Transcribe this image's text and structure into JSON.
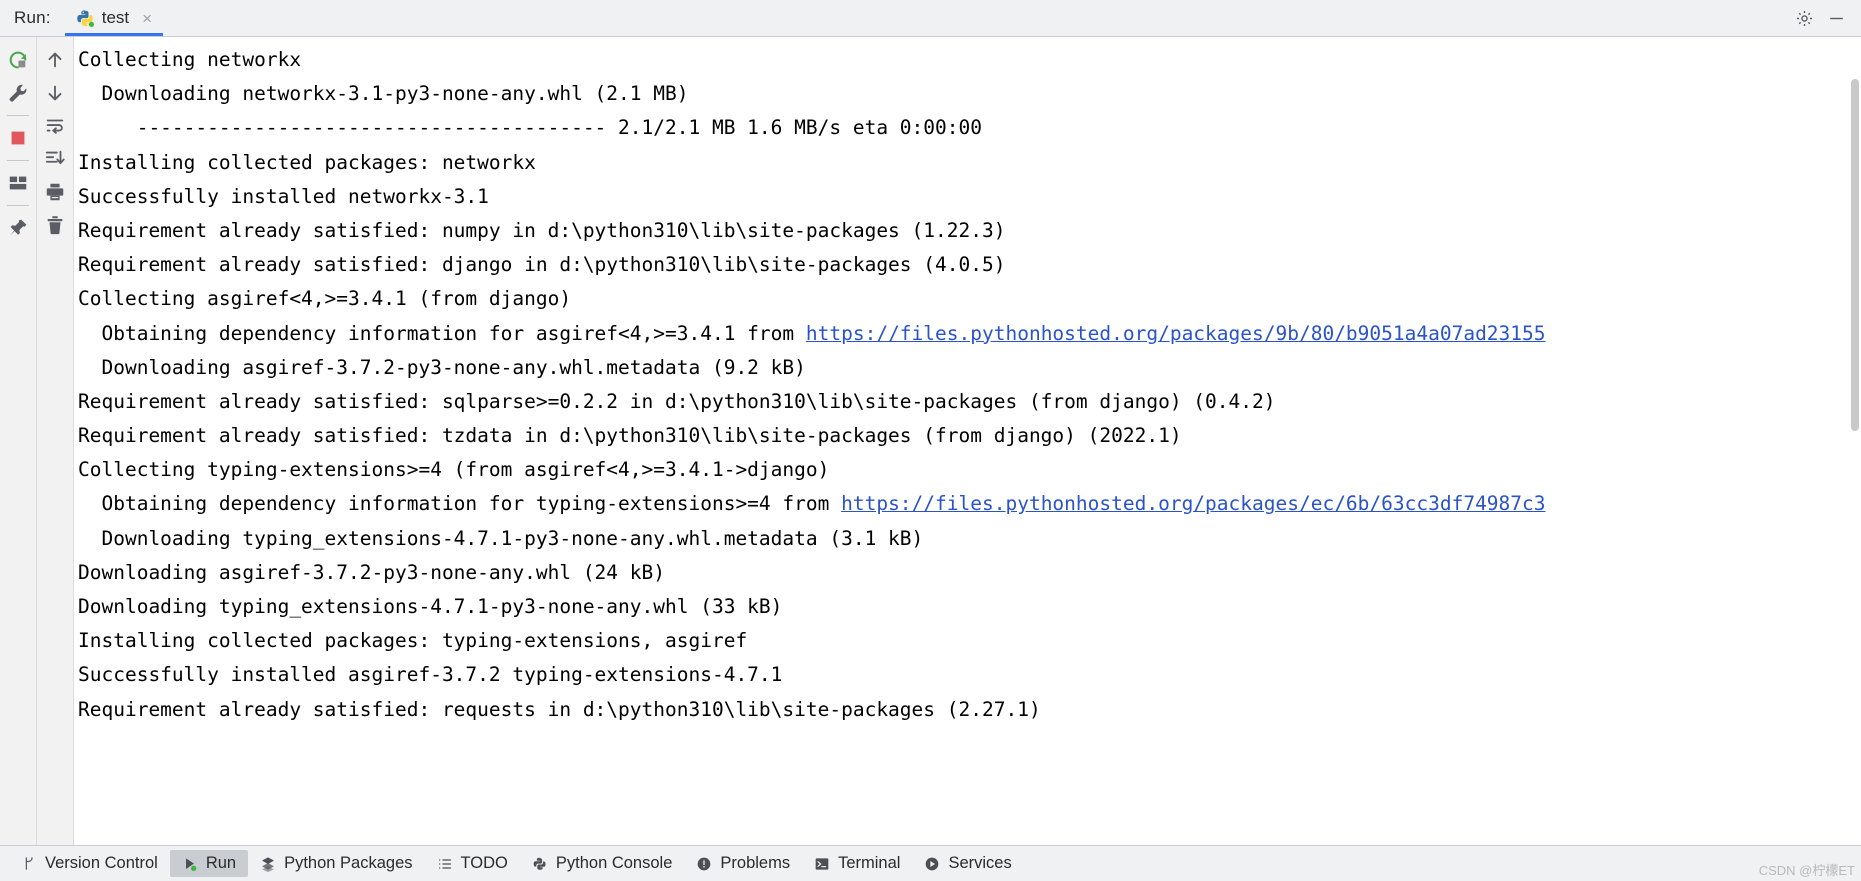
{
  "topbar": {
    "run_label": "Run:",
    "tab": {
      "title": "test",
      "close": "×",
      "icon": "python-icon"
    },
    "settings_icon": "gear-icon",
    "minimize_icon": "minimize-icon"
  },
  "gutter_left": [
    {
      "name": "rerun-icon",
      "label": "Rerun"
    },
    {
      "name": "wrench-icon",
      "label": "Modify Run Configuration"
    },
    {
      "name": "stop-icon",
      "label": "Stop"
    },
    {
      "name": "layout-icon",
      "label": "Layout"
    },
    {
      "name": "pin-icon",
      "label": "Pin Tab"
    }
  ],
  "gutter_right": [
    {
      "name": "arrow-up-icon",
      "label": "Up the Stack Trace"
    },
    {
      "name": "arrow-down-icon",
      "label": "Down the Stack Trace"
    },
    {
      "name": "soft-wrap-icon",
      "label": "Soft-Wrap"
    },
    {
      "name": "scroll-to-end-icon",
      "label": "Scroll to the End"
    },
    {
      "name": "print-icon",
      "label": "Print"
    },
    {
      "name": "trash-icon",
      "label": "Clear All"
    }
  ],
  "console": {
    "lines": [
      {
        "text": "Collecting networkx"
      },
      {
        "text": "  Downloading networkx-3.1-py3-none-any.whl (2.1 MB)"
      },
      {
        "text": "     ---------------------------------------- 2.1/2.1 MB 1.6 MB/s eta 0:00:00"
      },
      {
        "text": "Installing collected packages: networkx"
      },
      {
        "text": "Successfully installed networkx-3.1"
      },
      {
        "text": "Requirement already satisfied: numpy in d:\\python310\\lib\\site-packages (1.22.3)"
      },
      {
        "text": "Requirement already satisfied: django in d:\\python310\\lib\\site-packages (4.0.5)"
      },
      {
        "text": "Collecting asgiref<4,>=3.4.1 (from django)"
      },
      {
        "pre": "  Obtaining dependency information for asgiref<4,>=3.4.1 from ",
        "link": "https://files.pythonhosted.org/packages/9b/80/b9051a4a07ad23155",
        "post": ""
      },
      {
        "text": "  Downloading asgiref-3.7.2-py3-none-any.whl.metadata (9.2 kB)"
      },
      {
        "text": "Requirement already satisfied: sqlparse>=0.2.2 in d:\\python310\\lib\\site-packages (from django) (0.4.2)"
      },
      {
        "text": "Requirement already satisfied: tzdata in d:\\python310\\lib\\site-packages (from django) (2022.1)"
      },
      {
        "text": "Collecting typing-extensions>=4 (from asgiref<4,>=3.4.1->django)"
      },
      {
        "pre": "  Obtaining dependency information for typing-extensions>=4 from ",
        "link": "https://files.pythonhosted.org/packages/ec/6b/63cc3df74987c3",
        "post": ""
      },
      {
        "text": "  Downloading typing_extensions-4.7.1-py3-none-any.whl.metadata (3.1 kB)"
      },
      {
        "text": "Downloading asgiref-3.7.2-py3-none-any.whl (24 kB)"
      },
      {
        "text": "Downloading typing_extensions-4.7.1-py3-none-any.whl (33 kB)"
      },
      {
        "text": "Installing collected packages: typing-extensions, asgiref"
      },
      {
        "text": "Successfully installed asgiref-3.7.2 typing-extensions-4.7.1"
      },
      {
        "text": "Requirement already satisfied: requests in d:\\python310\\lib\\site-packages (2.27.1)"
      }
    ]
  },
  "statusbar": {
    "items": [
      {
        "label": "Version Control",
        "icon": "branch-icon",
        "active": false
      },
      {
        "label": "Run",
        "icon": "run-play-icon",
        "active": true
      },
      {
        "label": "Python Packages",
        "icon": "packages-icon",
        "active": false
      },
      {
        "label": "TODO",
        "icon": "todo-list-icon",
        "active": false
      },
      {
        "label": "Python Console",
        "icon": "python-console-icon",
        "active": false
      },
      {
        "label": "Problems",
        "icon": "problems-icon",
        "active": false
      },
      {
        "label": "Terminal",
        "icon": "terminal-icon",
        "active": false
      },
      {
        "label": "Services",
        "icon": "services-icon",
        "active": false
      }
    ],
    "watermark": "CSDN @柠檬ET"
  },
  "colors": {
    "accent": "#3574f0",
    "link": "#2a53c9",
    "stop_red": "#e0585e",
    "rerun_green": "#4caf50",
    "chrome_bg": "#eff1f3",
    "gutter_bg": "#f2f2f2",
    "console_bg": "#ffffff"
  }
}
